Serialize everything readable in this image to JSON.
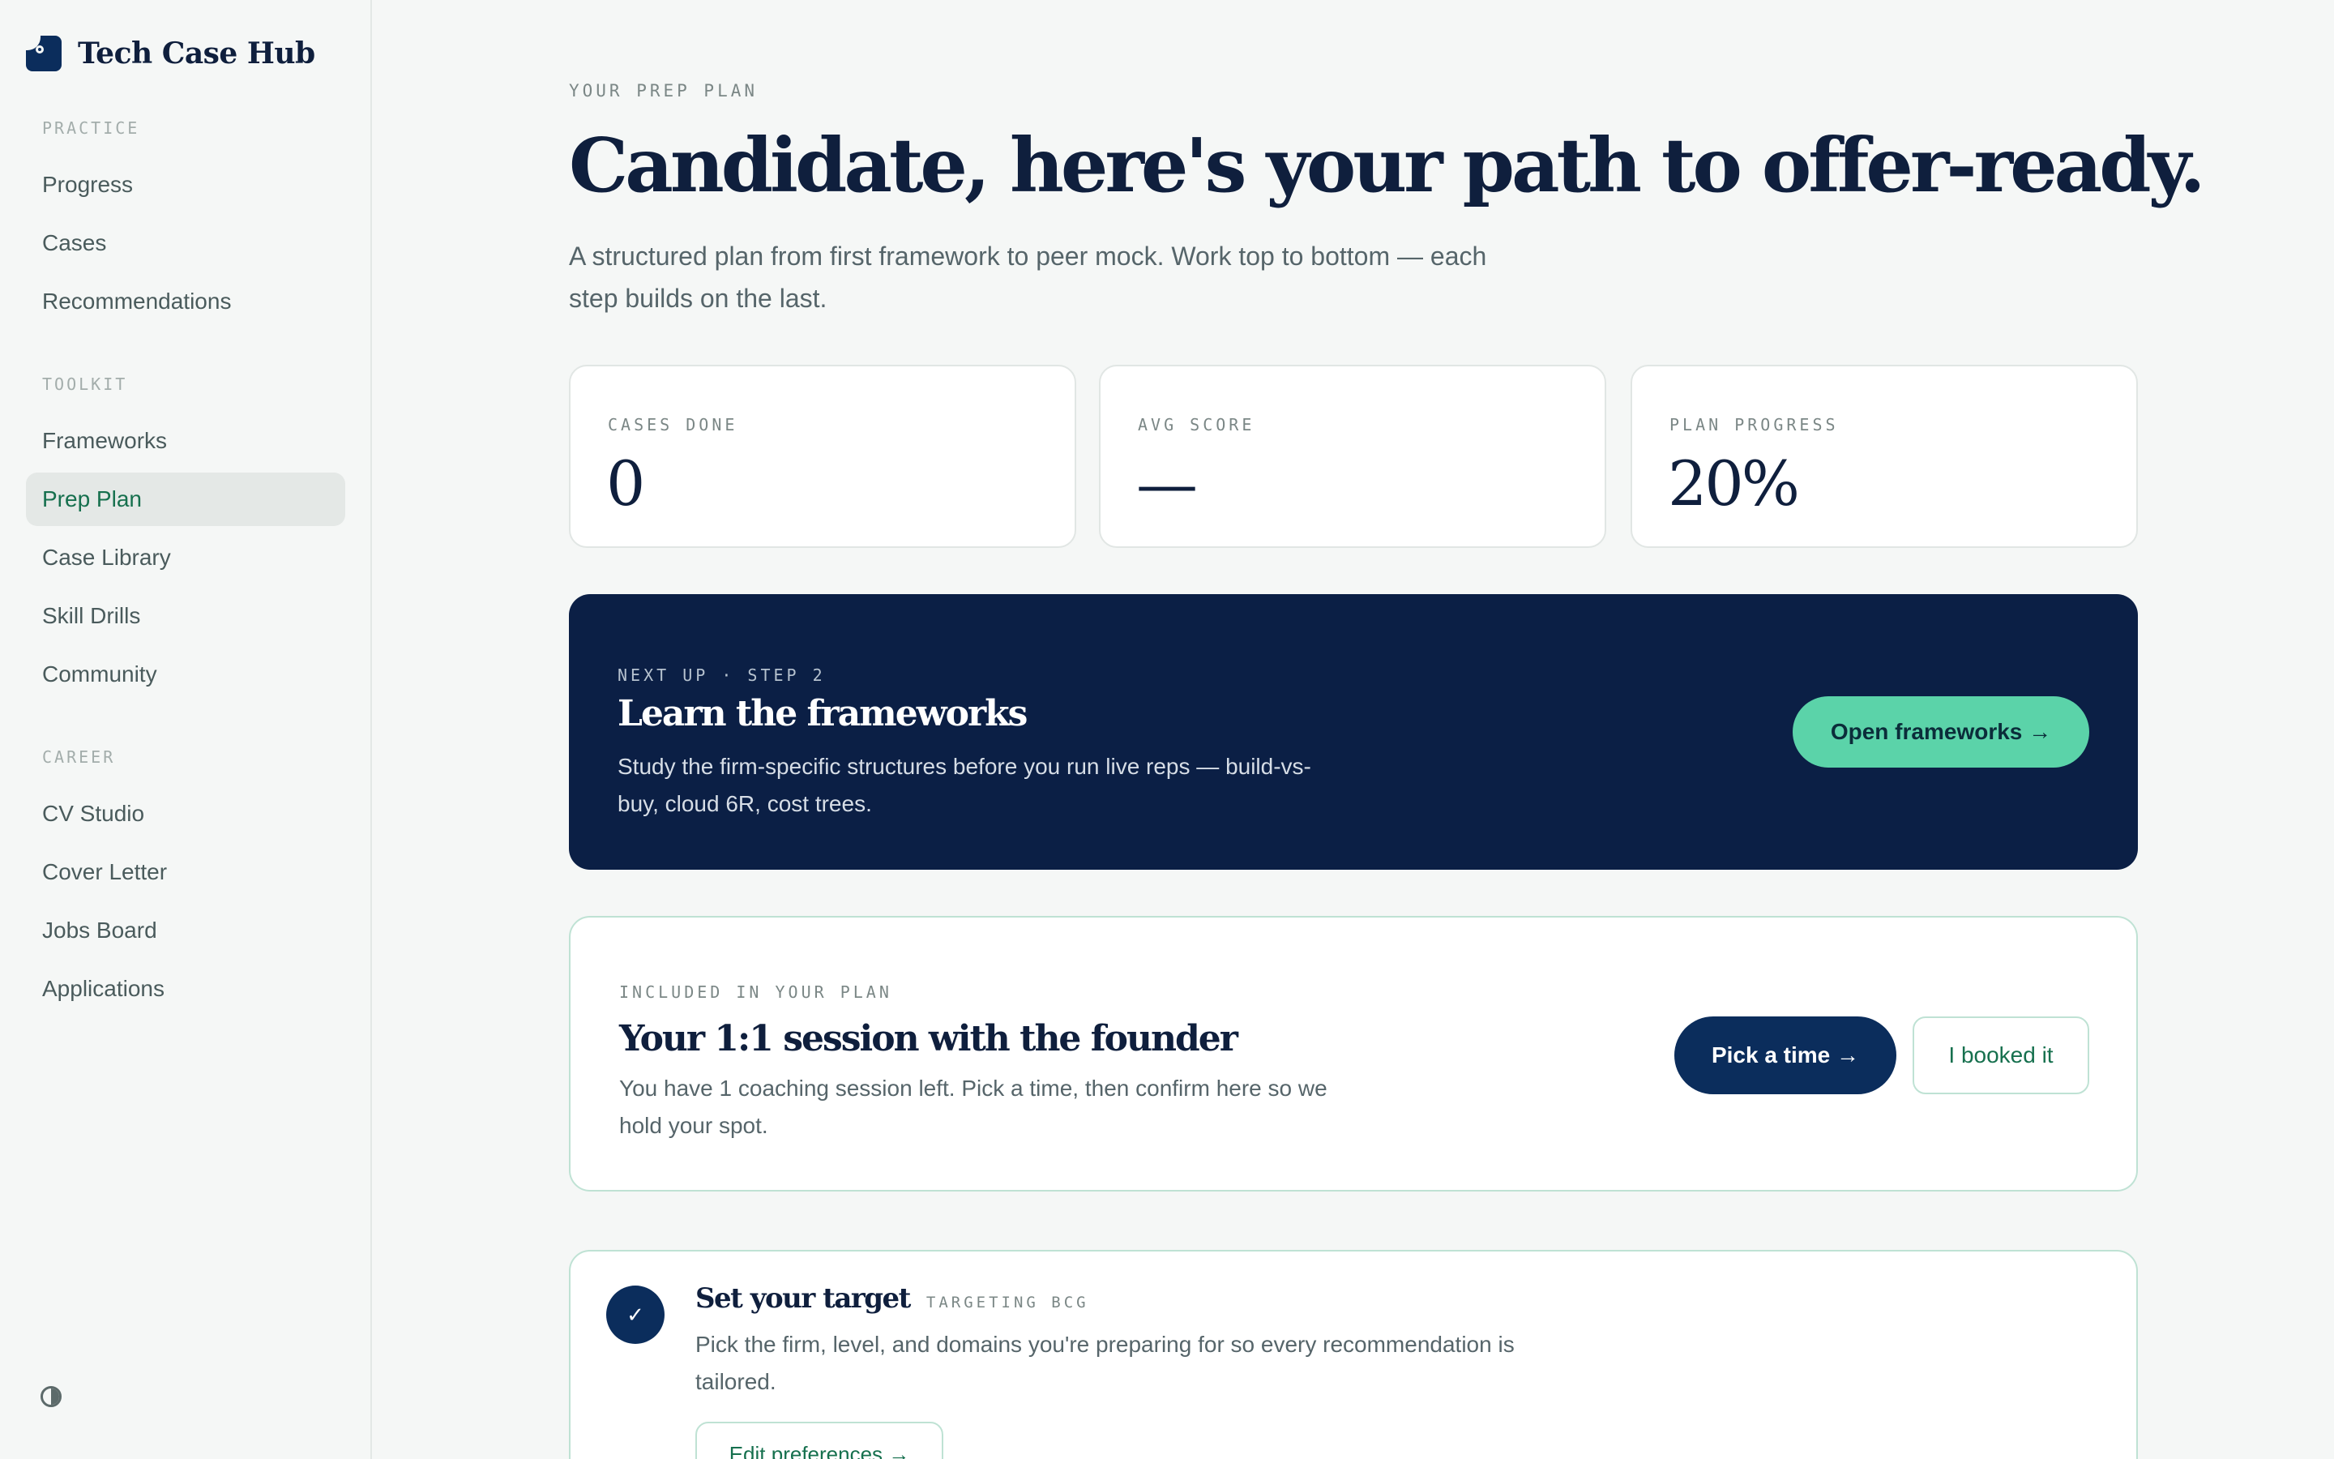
{
  "brand": {
    "name": "Tech Case Hub",
    "logo_icon": "brand-logo-icon"
  },
  "sidebar": {
    "groups": [
      {
        "label": "PRACTICE",
        "items": [
          "Progress",
          "Cases",
          "Recommendations"
        ]
      },
      {
        "label": "TOOLKIT",
        "items": [
          "Frameworks",
          "Prep Plan",
          "Case Library",
          "Skill Drills",
          "Community"
        ]
      },
      {
        "label": "CAREER",
        "items": [
          "CV Studio",
          "Cover Letter",
          "Jobs Board",
          "Applications"
        ]
      }
    ],
    "active_item": "Prep Plan",
    "theme_toggle_icon": "contrast-icon"
  },
  "hero": {
    "eyebrow": "YOUR PREP PLAN",
    "title": "Candidate, here's your path to offer-ready.",
    "subtitle": "A structured plan from first framework to peer mock. Work top to bottom — each step builds on the last."
  },
  "stats": [
    {
      "label": "CASES DONE",
      "value": "0"
    },
    {
      "label": "AVG SCORE",
      "value": "—"
    },
    {
      "label": "PLAN PROGRESS",
      "value": "20%"
    }
  ],
  "next_up": {
    "eyebrow": "NEXT UP · STEP 2",
    "title": "Learn the frameworks",
    "text": "Study the firm-specific structures before you run live reps — build-vs-buy, cloud 6R, cost trees.",
    "button": "Open frameworks →"
  },
  "session": {
    "eyebrow": "INCLUDED IN YOUR PLAN",
    "title": "Your 1:1 session with the founder",
    "text": "You have 1 coaching session left. Pick a time, then confirm here so we hold your spot.",
    "primary_button": "Pick a time →",
    "secondary_button": "I booked it"
  },
  "step_target": {
    "check": "✓",
    "title": "Set your target",
    "tag": "TARGETING BCG",
    "text": "Pick the firm, level, and domains you're preparing for so every recommendation is tailored.",
    "button": "Edit preferences →"
  },
  "colors": {
    "navy": "#0b1f45",
    "brand_navy": "#0b2d5c",
    "mint": "#5bd3a9",
    "active_green": "#16704e",
    "background": "#f5f7f6"
  }
}
